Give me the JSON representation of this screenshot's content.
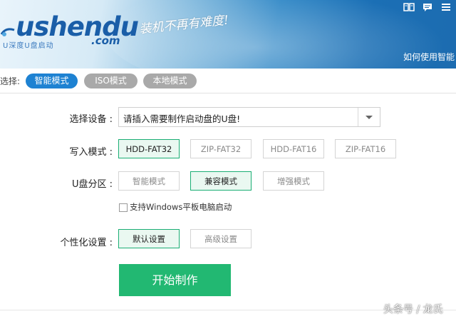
{
  "header": {
    "logo_main": "ushendu",
    "logo_dotcom": ".com",
    "logo_sub": "U深度U盘启动",
    "slogan": "装机不再有难度!",
    "help_link": "如何使用智能"
  },
  "mode_bar": {
    "label": "选择:",
    "modes": [
      {
        "label": "智能模式",
        "active": true
      },
      {
        "label": "ISO模式",
        "active": false
      },
      {
        "label": "本地模式",
        "active": false
      }
    ]
  },
  "form": {
    "device_label": "选择设备 :",
    "device_value": "请插入需要制作启动盘的U盘!",
    "write_label": "写入模式 :",
    "write_options": [
      "HDD-FAT32",
      "ZIP-FAT32",
      "HDD-FAT16",
      "ZIP-FAT16"
    ],
    "write_selected": "HDD-FAT32",
    "partition_label": "U盘分区 :",
    "partition_options": [
      "智能模式",
      "兼容模式",
      "增强模式"
    ],
    "partition_selected": "兼容模式",
    "tablet_checkbox_label": "支持Windows平板电脑启动",
    "tablet_checked": false,
    "custom_label": "个性化设置 :",
    "custom_options": [
      "默认设置",
      "高级设置"
    ],
    "custom_selected": "默认设置",
    "start_button": "开始制作"
  },
  "watermark": "头条号 / 龙氏",
  "colors": {
    "accent_blue": "#1e82d2",
    "accent_green": "#22b872",
    "selected_border": "#1aae74"
  }
}
